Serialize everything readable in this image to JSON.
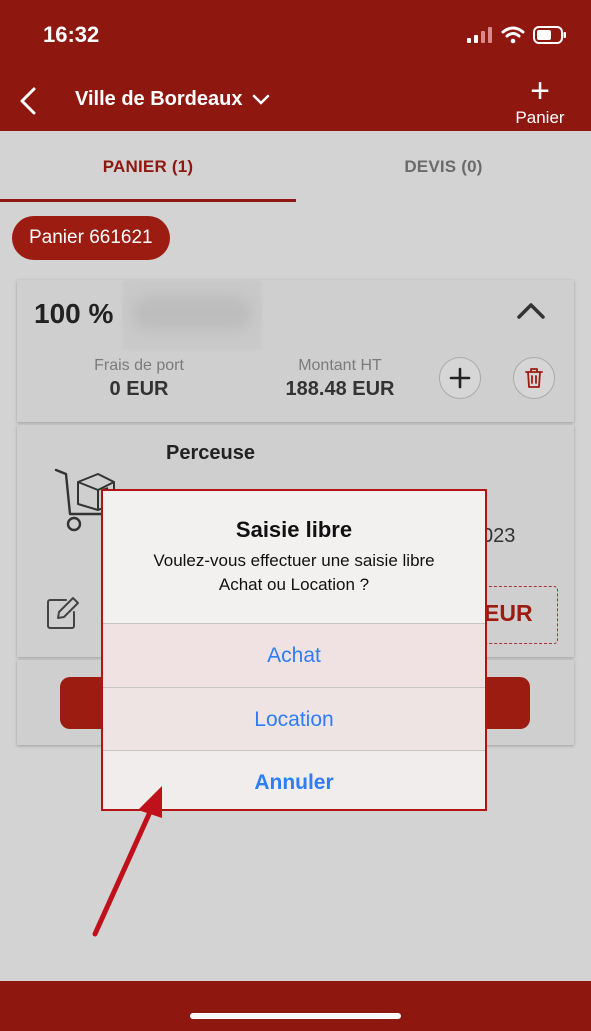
{
  "status": {
    "time": "16:32"
  },
  "header": {
    "title": "Ville de Bordeaux",
    "cart_label": "Panier",
    "cart_plus": "+"
  },
  "tabs": [
    {
      "label": "PANIER (1)"
    },
    {
      "label": "DEVIS (0)"
    }
  ],
  "chip": {
    "label": "Panier 661621"
  },
  "summary": {
    "percent": "100 %",
    "shipping_label": "Frais de port",
    "shipping_value": "0 EUR",
    "amount_label": "Montant HT",
    "amount_value": "188.48 EUR"
  },
  "item": {
    "name": "Perceuse",
    "date_fragment": "023",
    "price_fragment": "EUR"
  },
  "dialog": {
    "title": "Saisie libre",
    "message_line1": "Voulez-vous effectuer une saisie libre",
    "message_line2": "Achat ou Location ?",
    "btn_achat": "Achat",
    "btn_location": "Location",
    "btn_annuler": "Annuler"
  },
  "colors": {
    "brand": "#8e1810",
    "link": "#2e7df6",
    "annotation": "#c0101a"
  }
}
